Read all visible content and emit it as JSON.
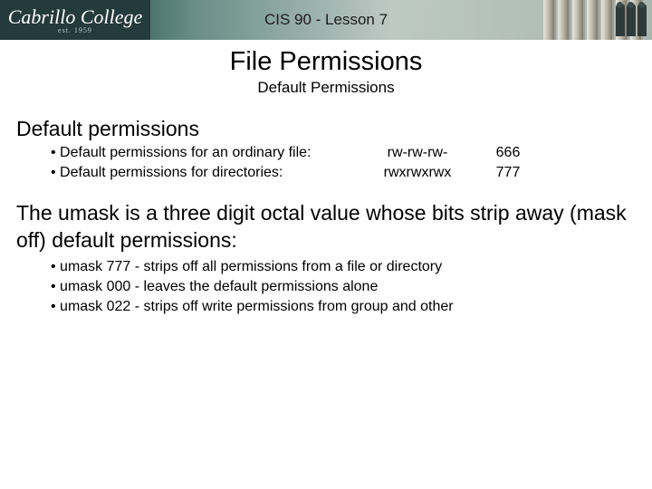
{
  "header": {
    "logo_text": "Cabrillo College",
    "logo_sub": "est. 1959",
    "course_title": "CIS 90 - Lesson 7"
  },
  "slide": {
    "title": "File Permissions",
    "subtitle": "Default Permissions",
    "section_heading": "Default permissions",
    "perm_rows": [
      {
        "label": "Default permissions for an ordinary file:",
        "perm": "rw-rw-rw-",
        "oct": "666"
      },
      {
        "label": "Default permissions for directories:",
        "perm": "rwxrwxrwx",
        "oct": "777"
      }
    ],
    "umask_paragraph": "The umask is a three digit octal value whose bits strip away (mask off) default permissions:",
    "umask_items": [
      "umask 777 - strips off all permissions from a file or directory",
      "umask 000 - leaves the default permissions alone",
      "umask 022 - strips off write permissions from group and other"
    ]
  }
}
